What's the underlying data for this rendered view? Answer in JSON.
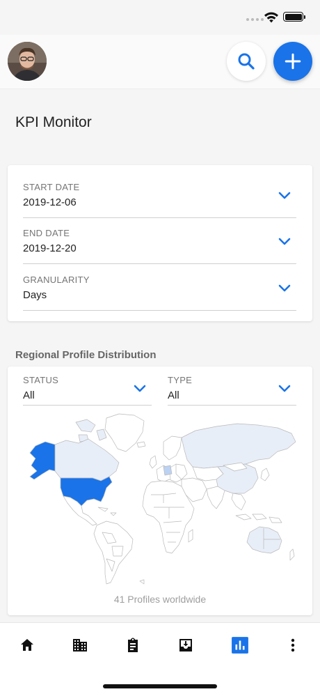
{
  "header": {
    "avatar_icon": "profile-photo",
    "search_icon": "search-icon",
    "add_icon": "plus-icon",
    "accent_color": "#1a73e8"
  },
  "page": {
    "title": "KPI Monitor"
  },
  "filters": {
    "start_date": {
      "label": "START DATE",
      "value": "2019-12-06"
    },
    "end_date": {
      "label": "END DATE",
      "value": "2019-12-20"
    },
    "granularity": {
      "label": "GRANULARITY",
      "value": "Days"
    }
  },
  "distribution": {
    "title": "Regional Profile Distribution",
    "status": {
      "label": "STATUS",
      "value": "All"
    },
    "type": {
      "label": "TYPE",
      "value": "All"
    },
    "caption": "41 Profiles worldwide",
    "colors": {
      "high": "#1a73e8",
      "low": "#e8eef8",
      "none": "#ffffff"
    }
  },
  "bottom_nav": {
    "items": [
      "home-icon",
      "business-icon",
      "assignment-icon",
      "inbox-icon",
      "chart-icon",
      "more-icon"
    ],
    "active": "chart-icon"
  }
}
